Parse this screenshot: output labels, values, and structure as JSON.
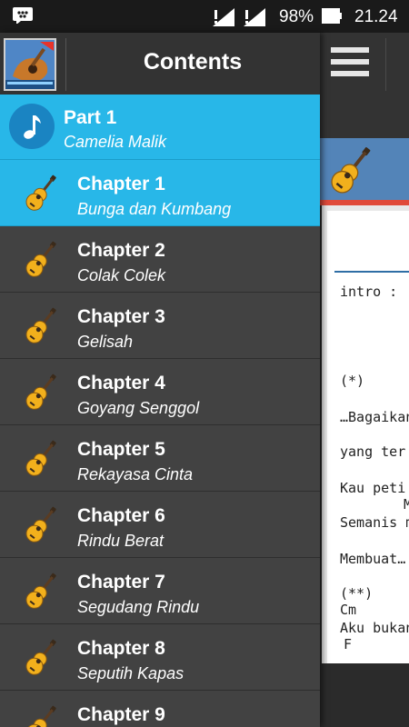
{
  "status_bar": {
    "battery_percent": "98%",
    "time": "21.24"
  },
  "drawer": {
    "title": "Contents",
    "part": {
      "title": "Part 1",
      "subtitle": "Camelia Malik"
    },
    "chapters": [
      {
        "title": "Chapter 1",
        "subtitle": "Bunga dan Kumbang",
        "selected": true
      },
      {
        "title": "Chapter 2",
        "subtitle": "Colak Colek"
      },
      {
        "title": "Chapter 3",
        "subtitle": "Gelisah"
      },
      {
        "title": "Chapter 4",
        "subtitle": "Goyang Senggol"
      },
      {
        "title": "Chapter 5",
        "subtitle": "Rekayasa Cinta"
      },
      {
        "title": "Chapter 6",
        "subtitle": "Rindu Berat"
      },
      {
        "title": "Chapter 7",
        "subtitle": "Segudang Rindu"
      },
      {
        "title": "Chapter 8",
        "subtitle": "Seputih Kapas"
      },
      {
        "title": "Chapter 9",
        "subtitle": ""
      }
    ]
  },
  "background_content": {
    "lines": [
      "intro :",
      "(*)",
      "…Bagaikan",
      "yang ter",
      "Kau peti",
      "M",
      "Semanis m",
      "Membuat…",
      "(**)",
      "Cm",
      "Aku bukan",
      "F"
    ]
  },
  "icons": {
    "status": [
      "bbm-icon",
      "wifi-signal-icon",
      "cell-signal-icon",
      "battery-icon"
    ],
    "toolbar": [
      "hamburger-menu-icon"
    ],
    "part": "music-note-icon",
    "chapter": "guitar-icon"
  },
  "colors": {
    "accent": "#28b7e8",
    "drawer_bg": "#424242",
    "header_bg": "#333333",
    "status_bar_bg": "#1a1a1a"
  }
}
